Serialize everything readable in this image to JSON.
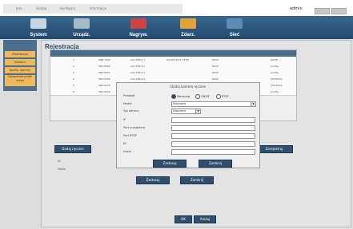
{
  "topbar": {
    "menu": [
      "Jeta",
      "Szukaj",
      "Konfiguru",
      "Informacje"
    ],
    "user": "admin"
  },
  "nav": [
    "System",
    "Urządz.",
    "Nagryw.",
    "Zdarz.",
    "Sieć"
  ],
  "sidebar": [
    "Rejestracja",
    "Kamera",
    "Konfig. kamery",
    "Ustawienia profili video"
  ],
  "page_title": "Rejestracja",
  "table": {
    "rows": [
      [
        "1",
        "SNB-7002",
        "192.168.0.1",
        "00:09:18:A7:73:FE",
        "8000",
        "ONVIF"
      ],
      [
        "2",
        "SNV-8080",
        "192.168.0.2",
        "",
        "8000",
        "Config"
      ],
      [
        "3",
        "SNP-6001",
        "192.168.0.3",
        "",
        "8000",
        "Config"
      ],
      [
        "4",
        "SNV-5080",
        "192.168.0.4",
        "",
        "8000",
        "SPS/SOLK"
      ],
      [
        "5",
        "SNP-6220",
        "192.168.0.5",
        "",
        "8000",
        "SPS/SOLK"
      ],
      [
        "6",
        "SNP-6320",
        "192.168.0.6",
        "",
        "8000",
        "Config"
      ]
    ]
  },
  "buttons": {
    "add_manual": "Dodaj ręcznie",
    "register": "Zarejestruj",
    "apply": "Zastosuj",
    "close": "Zamknij",
    "ok": "OK",
    "cancel": "Anuluj"
  },
  "dialog": {
    "title": "Dodaj kamerę ręcznie",
    "protocol_label": "Protokół",
    "protocols": [
      "Samsung",
      "ONVIF",
      "RTSP"
    ],
    "model_label": "Model",
    "model_value": "Nieznane",
    "address_type_label": "Typ adresu",
    "address_type_value": "Nieznane",
    "ip_label": "IP",
    "port_label": "Port urządzenia",
    "rtsp_label": "Port RTSP",
    "id_label": "ID",
    "password_label": "Hasło",
    "apply": "Zastosuj",
    "close": "Zamknij"
  },
  "footer": {
    "id_label": "ID",
    "password_label": "Hasło"
  }
}
